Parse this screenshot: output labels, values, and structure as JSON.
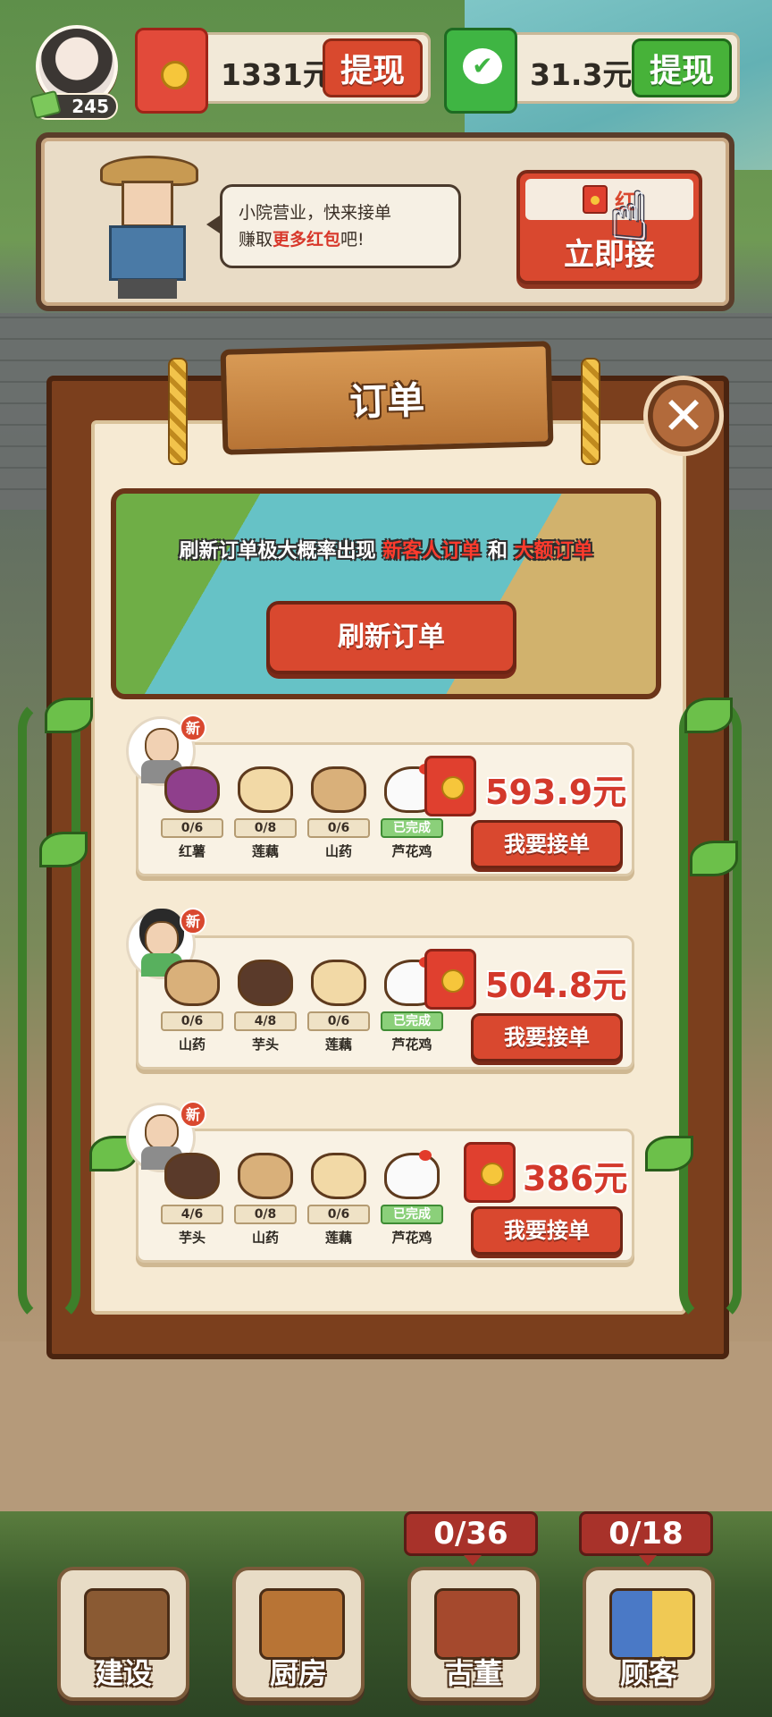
{
  "player": {
    "coins": "245",
    "red_packet_balance": "1331元",
    "wechat_balance": "31.3元",
    "withdraw_label": "提现"
  },
  "banner": {
    "speech_line1": "小院营业，快来接单",
    "speech_line2_prefix": "赚取",
    "speech_line2_highlight": "更多红包",
    "speech_line2_suffix": "吧!",
    "grab_top_label": "红",
    "grab_label": "立即接"
  },
  "orders_panel": {
    "title": "订单",
    "close_label": "✕",
    "promo_prefix": "刷新订单极大概率出现 ",
    "promo_red1": "新客人订单",
    "promo_mid": " 和 ",
    "promo_red2": "大额订单",
    "refresh_label": "刷新订单"
  },
  "orders": [
    {
      "new_label": "新",
      "ingredients": [
        {
          "name": "红薯",
          "progress": "0/6",
          "icon": "sweet-potato-icon"
        },
        {
          "name": "莲藕",
          "progress": "0/8",
          "icon": "lotus-root-icon"
        },
        {
          "name": "山药",
          "progress": "0/6",
          "icon": "yam-icon"
        },
        {
          "name": "芦花鸡",
          "progress": "已完成",
          "icon": "chicken-icon"
        }
      ],
      "reward": "593.9元",
      "accept_label": "我要接单"
    },
    {
      "new_label": "新",
      "ingredients": [
        {
          "name": "山药",
          "progress": "0/6",
          "icon": "yam-icon"
        },
        {
          "name": "芋头",
          "progress": "4/8",
          "icon": "taro-icon"
        },
        {
          "name": "莲藕",
          "progress": "0/6",
          "icon": "lotus-root-icon"
        },
        {
          "name": "芦花鸡",
          "progress": "已完成",
          "icon": "chicken-icon"
        }
      ],
      "reward": "504.8元",
      "accept_label": "我要接单"
    },
    {
      "new_label": "新",
      "ingredients": [
        {
          "name": "芋头",
          "progress": "4/6",
          "icon": "taro-icon"
        },
        {
          "name": "山药",
          "progress": "0/8",
          "icon": "yam-icon"
        },
        {
          "name": "莲藕",
          "progress": "0/6",
          "icon": "lotus-root-icon"
        },
        {
          "name": "芦花鸡",
          "progress": "已完成",
          "icon": "chicken-icon"
        }
      ],
      "reward": "386元",
      "accept_label": "我要接单"
    }
  ],
  "bottom_nav": {
    "antique_count": "0/36",
    "customer_count": "0/18",
    "items": [
      {
        "label": "建设",
        "icon": "toolbox-icon"
      },
      {
        "label": "厨房",
        "icon": "cooking-pot-icon"
      },
      {
        "label": "古董",
        "icon": "treasure-chest-icon"
      },
      {
        "label": "顾客",
        "icon": "customers-icon"
      }
    ]
  },
  "colors": {
    "accent_red": "#d9482f",
    "reward_red": "#d3382b",
    "wechat_green": "#47b239",
    "wood_dark": "#4a2410"
  }
}
